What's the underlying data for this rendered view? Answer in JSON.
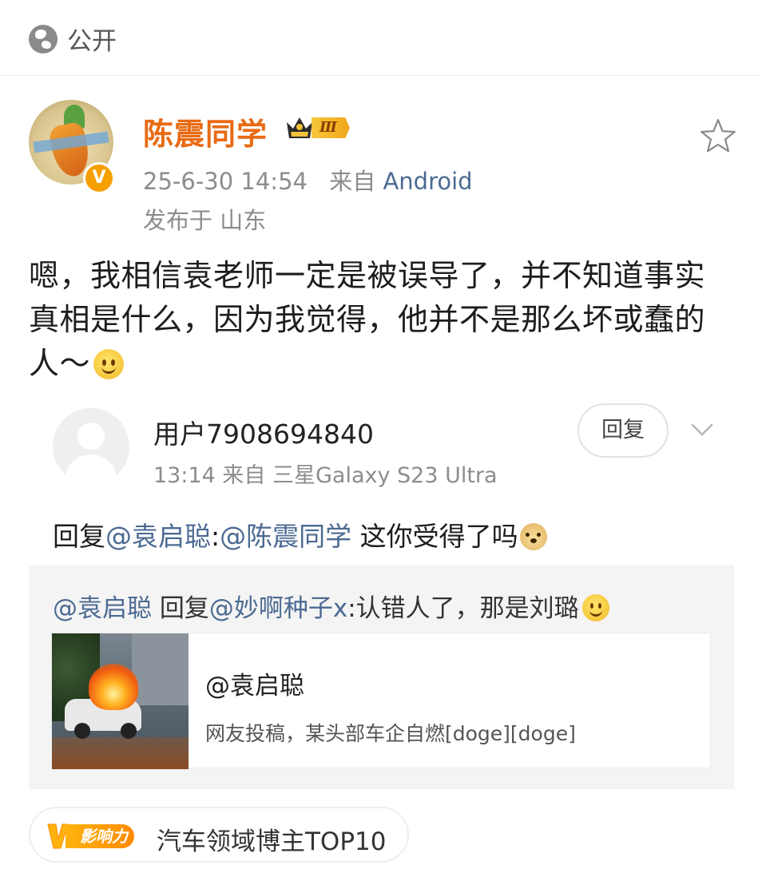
{
  "top": {
    "visibility": "公开"
  },
  "post": {
    "username": "陈震同学",
    "level": "Ⅲ",
    "time": "25-6-30 14:54",
    "from_label": "来自",
    "source": "Android",
    "location": "发布于 山东",
    "body": "嗯，我相信袁老师一定是被误导了，并不知道事实真相是什么，因为我觉得，他并不是那么坏或蠢的人～"
  },
  "comment": {
    "username": "用户7908694840",
    "meta": "13:14  来自 三星Galaxy S23 Ultra",
    "reply_button": "回复",
    "text_prefix": "回复",
    "mention1": "@袁启聪",
    "colon": ":",
    "mention2": "@陈震同学",
    "text_suffix": " 这你受得了吗"
  },
  "quote": {
    "mention1": "@袁启聪",
    "reply_word": " 回复",
    "mention2": "@妙啊种子x",
    "text": ":认错人了，那是刘璐",
    "card": {
      "title": "@袁启聪",
      "desc": "网友投稿，某头部车企自燃[doge][doge]"
    }
  },
  "influence": {
    "badge_label": "影响力",
    "text": "汽车领域博主TOP10"
  },
  "colors": {
    "username": "#e86b14",
    "link": "#4b6a92",
    "badge": "#f6a000"
  },
  "icons": [
    "globe-icon",
    "crown-icon",
    "verified-icon",
    "star-icon",
    "chevron-down-icon",
    "smile-emoji-icon",
    "doge-emoji-icon",
    "influence-v-icon"
  ]
}
